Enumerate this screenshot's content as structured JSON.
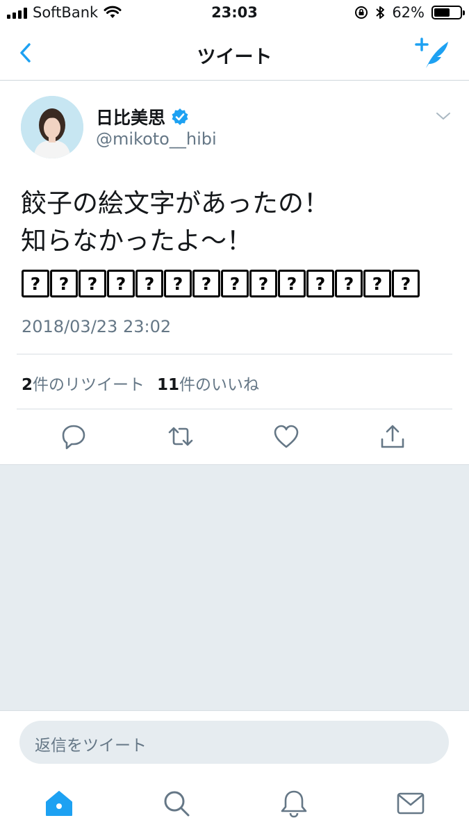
{
  "status_bar": {
    "carrier": "SoftBank",
    "time": "23:03",
    "battery_percent": "62%",
    "battery_level": 0.62,
    "icons": [
      "signal-icon",
      "wifi-icon",
      "rotation-lock-icon",
      "bluetooth-icon",
      "battery-icon"
    ]
  },
  "nav": {
    "title": "ツイート",
    "back_icon": "chevron-left-icon",
    "compose_icon": "compose-tweet-icon"
  },
  "tweet": {
    "display_name": "日比美思",
    "handle": "@mikoto__hibi",
    "verified": true,
    "text_lines": [
      "餃子の絵文字があったの！",
      "知らなかったよ〜！"
    ],
    "emoji_placeholders": [
      "?",
      "?",
      "?",
      "?",
      "?",
      "?",
      "?",
      "?",
      "?",
      "?",
      "?",
      "?",
      "?",
      "?"
    ],
    "timestamp": "2018/03/23 23:02",
    "retweet_count": "2",
    "retweet_label": "件のリツイート",
    "like_count": "11",
    "like_label": "件のいいね"
  },
  "reply": {
    "placeholder": "返信をツイート"
  },
  "colors": {
    "accent": "#1da1f2",
    "text": "#14171a",
    "secondary": "#657786",
    "background_grey": "#e6ecf0"
  },
  "tabs": [
    "home-icon",
    "search-icon",
    "notifications-icon",
    "messages-icon"
  ]
}
